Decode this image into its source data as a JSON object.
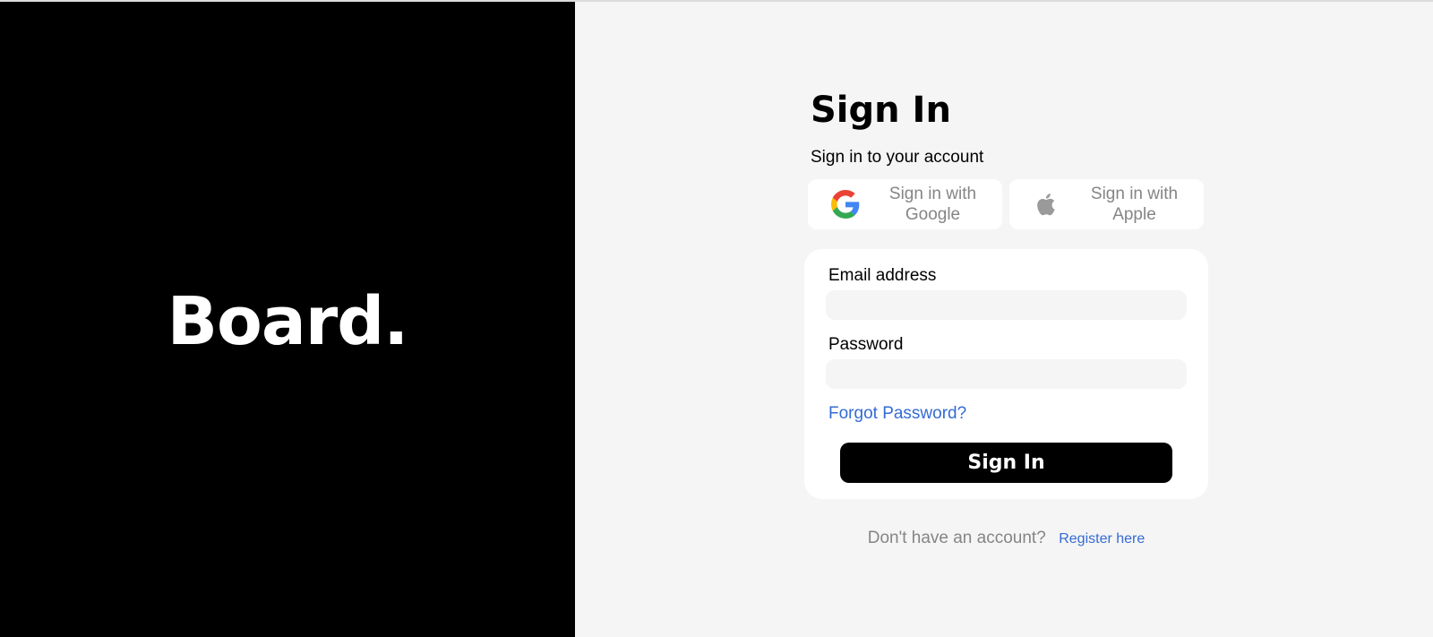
{
  "brand": {
    "logo_text": "Board."
  },
  "signin": {
    "title": "Sign In",
    "subtitle": "Sign in to your account",
    "social": {
      "google_label": "Sign in with Google",
      "apple_label": "Sign in with Apple",
      "google_icon": "google-g-icon",
      "apple_icon": "apple-logo-icon"
    },
    "form": {
      "email_label": "Email address",
      "email_value": "",
      "password_label": "Password",
      "password_value": "",
      "forgot_label": "Forgot Password?",
      "submit_label": "Sign In"
    },
    "register": {
      "prompt": "Don't have an account?",
      "link_label": "Register here"
    }
  },
  "colors": {
    "left_panel": "#000000",
    "page_background": "#f5f5f5",
    "card_background": "#ffffff",
    "link": "#346bd4",
    "muted_text": "#858585",
    "primary_button": "#000000"
  }
}
